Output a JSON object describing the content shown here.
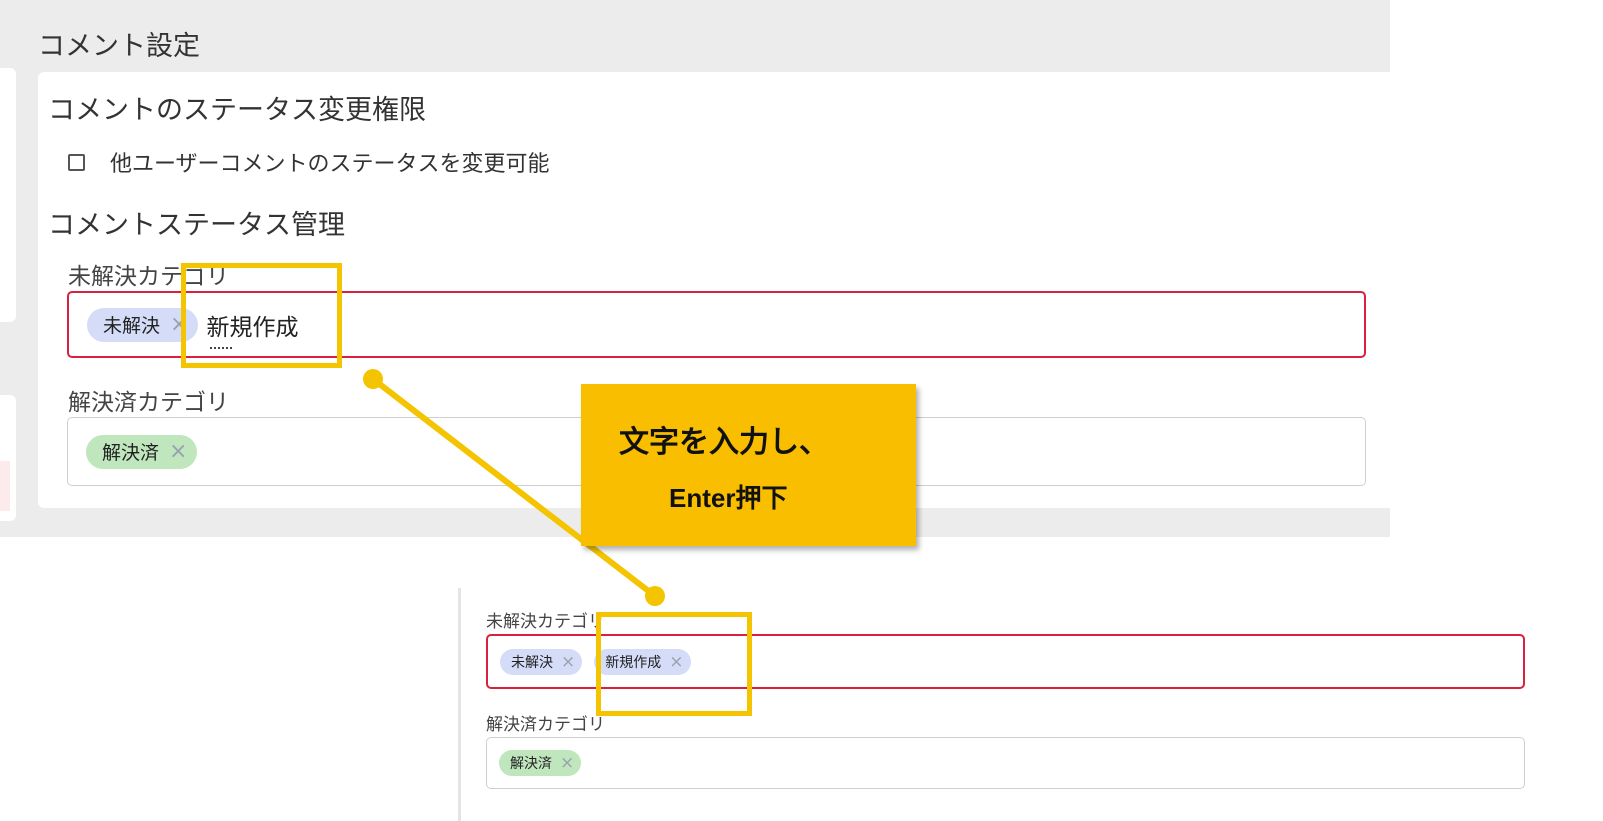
{
  "section_title": "コメント設定",
  "permission": {
    "heading": "コメントのステータス変更権限",
    "checkbox_label": "他ユーザーコメントのステータスを変更可能",
    "checked": false
  },
  "status_management": {
    "heading": "コメントステータス管理",
    "unresolved_label": "未解決カテゴリ",
    "unresolved_tags": [
      "未解決"
    ],
    "unresolved_typing": "新規作成",
    "resolved_label": "解決済カテゴリ",
    "resolved_tags": [
      "解決済"
    ]
  },
  "result": {
    "unresolved_label": "未解決カテゴリ",
    "unresolved_tags": [
      "未解決",
      "新規作成"
    ],
    "resolved_label": "解決済カテゴリ",
    "resolved_tags": [
      "解決済"
    ]
  },
  "callout": {
    "line1": "文字を入力し、",
    "line2": "Enter押下"
  },
  "icons": {
    "remove": "×"
  },
  "colors": {
    "highlight": "#f4c400",
    "callout_bg": "#f9be00",
    "error_border": "#d8213d",
    "chip_blue": "#d4dcf8",
    "chip_green": "#bfe6bd"
  }
}
